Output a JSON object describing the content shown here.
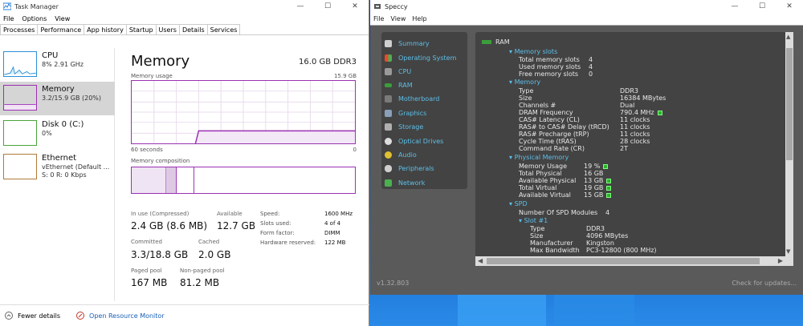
{
  "taskmanager": {
    "title": "Task Manager",
    "menu": [
      "File",
      "Options",
      "View"
    ],
    "tabs": [
      "Processes",
      "Performance",
      "App history",
      "Startup",
      "Users",
      "Details",
      "Services"
    ],
    "sidebar": [
      {
        "name": "CPU",
        "sub": "8%  2.91 GHz"
      },
      {
        "name": "Memory",
        "sub": "3.2/15.9 GB (20%)"
      },
      {
        "name": "Disk 0 (C:)",
        "sub": "0%"
      },
      {
        "name": "Ethernet",
        "sub": "vEthernet (Default ...",
        "sub2": "S: 0  R: 0 Kbps"
      }
    ],
    "main": {
      "title": "Memory",
      "spec": "16.0 GB DDR3",
      "usage_label": "Memory usage",
      "usage_max": "15.9 GB",
      "time_left": "60 seconds",
      "time_right": "0",
      "composition_label": "Memory composition"
    },
    "stats": {
      "inuse_label": "In use (Compressed)",
      "inuse_value": "2.4 GB (8.6 MB)",
      "avail_label": "Available",
      "avail_value": "12.7 GB",
      "committed_label": "Committed",
      "committed_value": "3.3/18.8 GB",
      "cached_label": "Cached",
      "cached_value": "2.0 GB",
      "paged_label": "Paged pool",
      "paged_value": "167 MB",
      "nonpaged_label": "Non-paged pool",
      "nonpaged_value": "81.2 MB",
      "speed_label": "Speed:",
      "speed_value": "1600 MHz",
      "slots_label": "Slots used:",
      "slots_value": "4 of 4",
      "form_label": "Form factor:",
      "form_value": "DIMM",
      "hwres_label": "Hardware reserved:",
      "hwres_value": "122 MB"
    },
    "footer": {
      "fewer": "Fewer details",
      "monitor": "Open Resource Monitor"
    }
  },
  "speccy": {
    "title": "Speccy",
    "menu": [
      "File",
      "View",
      "Help"
    ],
    "nav": [
      "Summary",
      "Operating System",
      "CPU",
      "RAM",
      "Motherboard",
      "Graphics",
      "Storage",
      "Optical Drives",
      "Audio",
      "Peripherals",
      "Network"
    ],
    "version": "v1.32.803",
    "updates": "Check for updates...",
    "content": {
      "ram": "RAM",
      "slots_head": "Memory slots",
      "total_slots": [
        "Total memory slots",
        "4"
      ],
      "used_slots": [
        "Used memory slots",
        "4"
      ],
      "free_slots": [
        "Free memory slots",
        "0"
      ],
      "mem_head": "Memory",
      "type": [
        "Type",
        "DDR3"
      ],
      "size": [
        "Size",
        "16384 MBytes"
      ],
      "channels": [
        "Channels #",
        "Dual"
      ],
      "dram": [
        "DRAM Frequency",
        "790.4 MHz"
      ],
      "cas": [
        "CAS# Latency (CL)",
        "11 clocks"
      ],
      "rcd": [
        "RAS# to CAS# Delay (tRCD)",
        "11 clocks"
      ],
      "rp": [
        "RAS# Precharge (tRP)",
        "11 clocks"
      ],
      "ras": [
        "Cycle Time (tRAS)",
        "28 clocks"
      ],
      "cr": [
        "Command Rate (CR)",
        "2T"
      ],
      "phys_head": "Physical Memory",
      "usage": [
        "Memory Usage",
        "19 %"
      ],
      "tphys": [
        "Total Physical",
        "16 GB"
      ],
      "aphys": [
        "Available Physical",
        "13 GB"
      ],
      "tvirt": [
        "Total Virtual",
        "19 GB"
      ],
      "avirt": [
        "Available Virtual",
        "15 GB"
      ],
      "spd_head": "SPD",
      "spd_num": [
        "Number Of SPD Modules",
        "4"
      ],
      "slot1": "Slot #1",
      "s_type": [
        "Type",
        "DDR3"
      ],
      "s_size": [
        "Size",
        "4096 MBytes"
      ],
      "s_manu": [
        "Manufacturer",
        "Kingston"
      ],
      "s_bw": [
        "Max Bandwidth",
        "PC3-12800 (800 MHz)"
      ]
    }
  }
}
